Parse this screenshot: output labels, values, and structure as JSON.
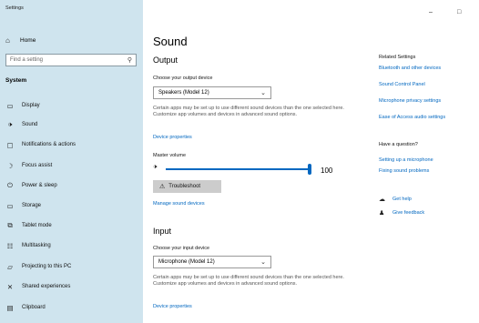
{
  "window": {
    "title": "Settings",
    "minimize_glyph": "–",
    "maximize_glyph": "□"
  },
  "sidebar": {
    "home": {
      "label": "Home",
      "icon": "home-icon"
    },
    "search": {
      "placeholder": "Find a setting"
    },
    "section": "System",
    "items": [
      {
        "label": "Display",
        "icon": "display-icon"
      },
      {
        "label": "Sound",
        "icon": "sound-icon"
      },
      {
        "label": "Notifications & actions",
        "icon": "notifications-icon"
      },
      {
        "label": "Focus assist",
        "icon": "focus-assist-icon"
      },
      {
        "label": "Power & sleep",
        "icon": "power-icon"
      },
      {
        "label": "Storage",
        "icon": "storage-icon"
      },
      {
        "label": "Tablet mode",
        "icon": "tablet-mode-icon"
      },
      {
        "label": "Multitasking",
        "icon": "multitasking-icon"
      },
      {
        "label": "Projecting to this PC",
        "icon": "projecting-icon"
      },
      {
        "label": "Shared experiences",
        "icon": "shared-experiences-icon"
      },
      {
        "label": "Clipboard",
        "icon": "clipboard-icon"
      }
    ]
  },
  "main": {
    "title": "Sound",
    "output": {
      "heading": "Output",
      "device_label": "Choose your output device",
      "device_value": "Speakers (Model 12)",
      "desc": "Certain apps may be set up to use different sound devices than the one selected here. Customize app volumes and devices in advanced sound options.",
      "device_properties": "Device properties",
      "volume_label": "Master volume",
      "volume_value": "100",
      "troubleshoot": "Troubleshoot",
      "manage": "Manage sound devices"
    },
    "input": {
      "heading": "Input",
      "device_label": "Choose your input device",
      "device_value": "Microphone (Model 12)",
      "desc": "Certain apps may be set up to use different sound devices than the one selected here. Customize app volumes and devices in advanced sound options.",
      "device_properties": "Device properties"
    }
  },
  "related": {
    "title": "Related Settings",
    "links": [
      "Bluetooth and other devices",
      "Sound Control Panel",
      "Microphone privacy settings",
      "Ease of Access audio settings"
    ],
    "question_title": "Have a question?",
    "question_links": [
      "Setting up a microphone",
      "Fixing sound problems"
    ],
    "help": "Get help",
    "feedback": "Give feedback"
  },
  "colors": {
    "sidebar_bg": "#cfe4ee",
    "accent": "#0067c0"
  }
}
